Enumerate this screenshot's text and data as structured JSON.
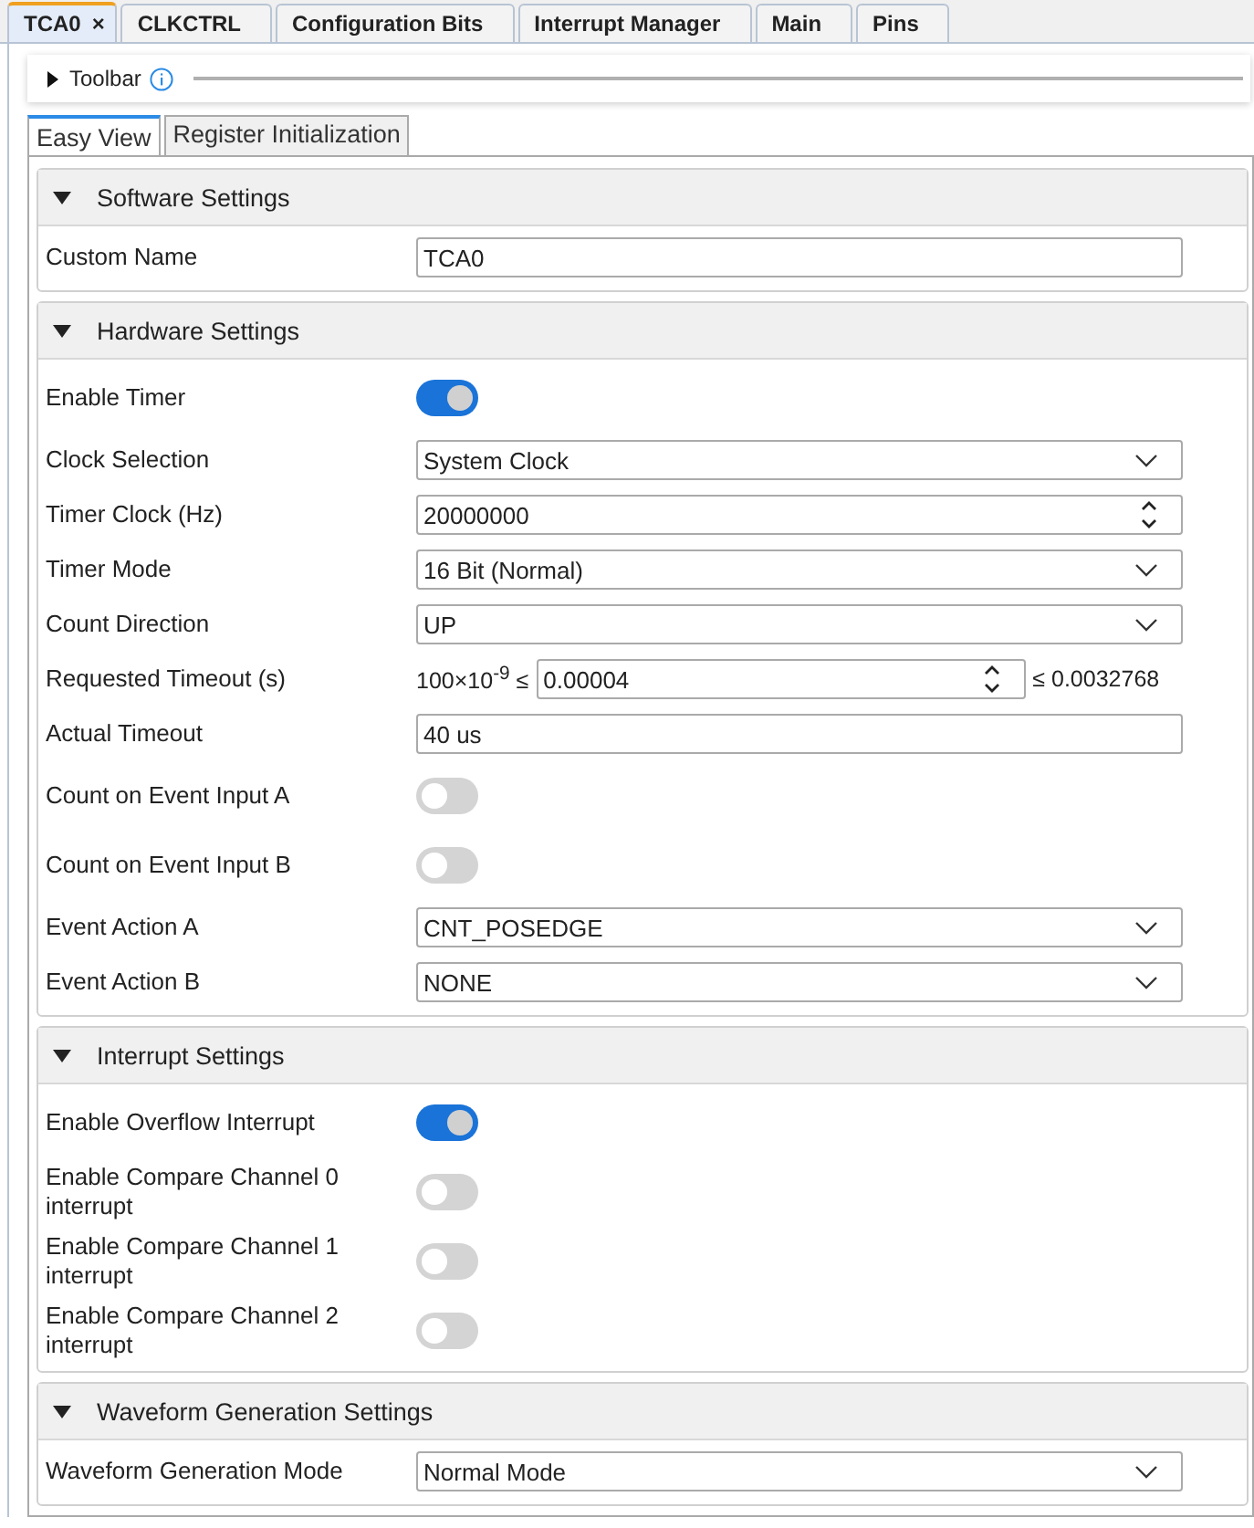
{
  "tabs": [
    {
      "label": "TCA0",
      "selected": true,
      "closable": true
    },
    {
      "label": "CLKCTRL",
      "selected": false,
      "closable": false
    },
    {
      "label": "Configuration Bits",
      "selected": false,
      "closable": false
    },
    {
      "label": "Interrupt Manager",
      "selected": false,
      "closable": false
    },
    {
      "label": "Main",
      "selected": false,
      "closable": false
    },
    {
      "label": "Pins",
      "selected": false,
      "closable": false
    }
  ],
  "close_glyph": "×",
  "toolbar": {
    "label": "Toolbar",
    "expanded": false
  },
  "view_tabs": [
    {
      "label": "Easy View",
      "selected": true
    },
    {
      "label": "Register Initialization",
      "selected": false
    }
  ],
  "sections": [
    {
      "title": "Software Settings",
      "expanded": true,
      "rows": [
        {
          "kind": "text",
          "label": "Custom Name",
          "value": "TCA0"
        }
      ]
    },
    {
      "title": "Hardware Settings",
      "expanded": true,
      "rows": [
        {
          "kind": "toggle",
          "label": "Enable Timer",
          "on": true
        },
        {
          "kind": "select",
          "label": "Clock Selection",
          "value": "System Clock"
        },
        {
          "kind": "spinner",
          "label": "Timer Clock (Hz)",
          "value": "20000000"
        },
        {
          "kind": "select",
          "label": "Timer Mode",
          "value": "16 Bit (Normal)"
        },
        {
          "kind": "select",
          "label": "Count Direction",
          "value": "UP"
        },
        {
          "kind": "range",
          "label": "Requested Timeout (s)",
          "min": "100×10$^{-9}$ ≤",
          "value": "0.00004",
          "max": "≤ 0.0032768"
        },
        {
          "kind": "text",
          "label": "Actual Timeout",
          "value": "40 us"
        },
        {
          "kind": "toggle",
          "label": "Count on Event Input A",
          "on": false
        },
        {
          "kind": "toggle",
          "label": "Count on Event Input B",
          "on": false
        },
        {
          "kind": "select",
          "label": "Event Action A",
          "value": "CNT_POSEDGE"
        },
        {
          "kind": "select",
          "label": "Event Action B",
          "value": "NONE"
        }
      ]
    },
    {
      "title": "Interrupt Settings",
      "expanded": true,
      "rows": [
        {
          "kind": "toggle",
          "label": "Enable Overflow Interrupt",
          "on": true
        },
        {
          "kind": "toggle",
          "label": "Enable Compare Channel 0 interrupt",
          "on": false
        },
        {
          "kind": "toggle",
          "label": "Enable Compare Channel 1 interrupt",
          "on": false
        },
        {
          "kind": "toggle",
          "label": "Enable Compare Channel 2 interrupt",
          "on": false
        }
      ]
    },
    {
      "title": "Waveform Generation Settings",
      "expanded": true,
      "rows": [
        {
          "kind": "select",
          "label": "Waveform Generation Mode",
          "value": "Normal Mode"
        }
      ]
    }
  ]
}
